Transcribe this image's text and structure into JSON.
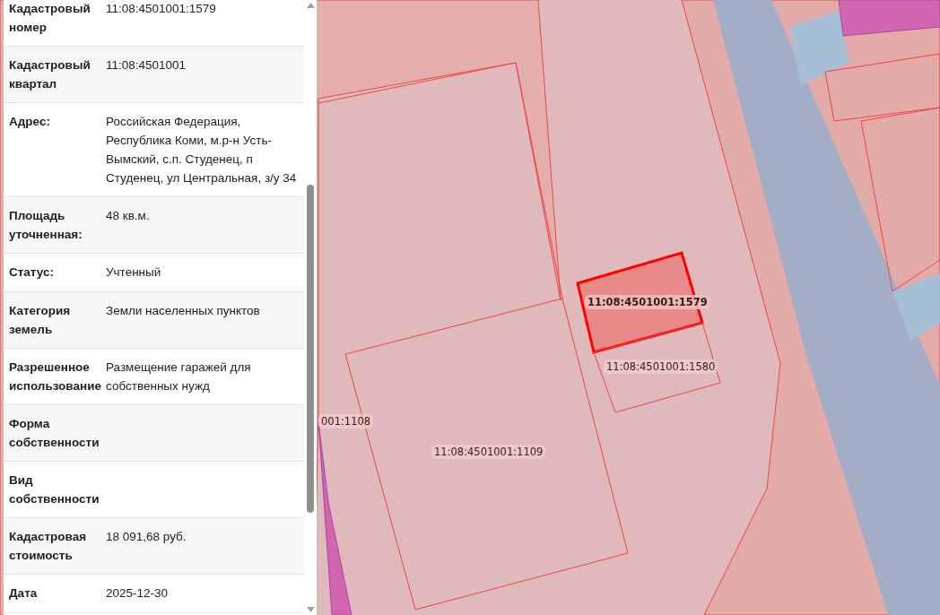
{
  "info_rows": [
    {
      "label": "Кадастровый номер",
      "value": "11:08:4501001:1579"
    },
    {
      "label": "Кадастровый квартал",
      "value": "11:08:4501001"
    },
    {
      "label": "Адрес:",
      "value": "Российская Федерация, Республика Коми, м.р-н Усть-Вымский, с.п. Студенец, п Студенец, ул Центральная, з/у 34"
    },
    {
      "label": "Площадь уточненная:",
      "value": "48 кв.м."
    },
    {
      "label": "Статус:",
      "value": "Учтенный"
    },
    {
      "label": "Категория земель",
      "value": "Земли населенных пунктов"
    },
    {
      "label": "Разрешенное использование",
      "value": "Размещение гаражей для собственных нужд"
    },
    {
      "label": "Форма собственности"
    },
    {
      "label": "Вид собственности"
    },
    {
      "label": "Кадастровая стоимость",
      "value": "18 091,68 руб."
    },
    {
      "label": "Дата",
      "value": "2025-12-30"
    }
  ],
  "map": {
    "parcels": [
      {
        "label": "11:08:4501001:1579",
        "selected": true
      },
      {
        "label": "11:08:4501001:1580",
        "selected": false
      },
      {
        "label": "001:1108",
        "selected": false
      },
      {
        "label": "11:08:4501001:1109",
        "selected": false
      }
    ]
  }
}
